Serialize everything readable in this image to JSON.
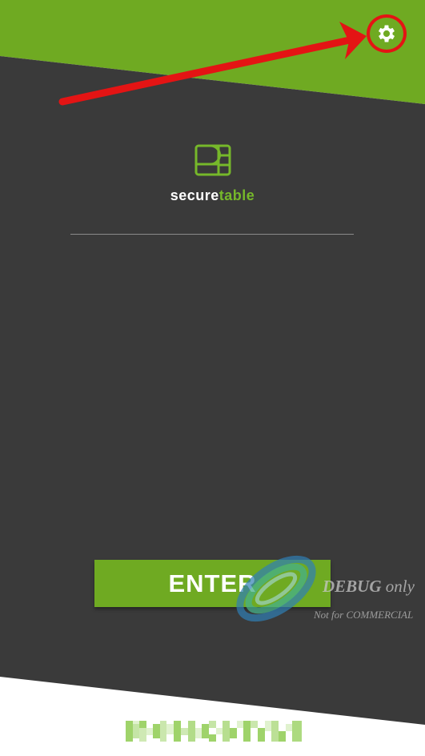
{
  "app": {
    "brand_part1": "secure",
    "brand_part2": "table",
    "logo_icon": "table-layout-icon"
  },
  "header": {
    "settings_icon": "gear-icon",
    "settings_highlight_color": "#e41414"
  },
  "main": {
    "enter_label": "ENTER"
  },
  "watermark": {
    "debug_word": "DEBUG",
    "only_word": "only",
    "note": "Not for COMMERCIAL"
  },
  "footer": {
    "version_text_pixelated": true
  },
  "colors": {
    "accent_green": "#6faa22",
    "brand_green": "#76b82a",
    "dark_background": "#3a3a3a",
    "annotation_red": "#e41414"
  }
}
